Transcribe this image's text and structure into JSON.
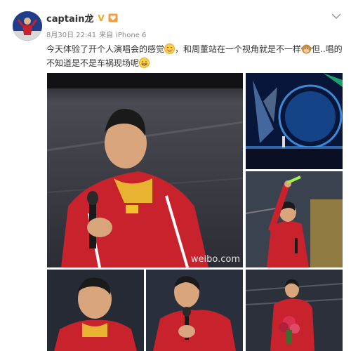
{
  "post": {
    "username": "captain龙",
    "date": "8月30日 22:41",
    "source_prefix": "来自",
    "source": "iPhone 6",
    "text_segments": [
      "今天体验了开个人演唱会的感觉",
      "，和周董站在一个视角就是不一样",
      "但..唱的不知道是不是车祸现场呢"
    ]
  },
  "icons": {
    "avatar": "user-avatar",
    "verified": "verified-v-icon",
    "member": "member-heart-icon",
    "dropdown": "chevron-down-icon",
    "emoji_1": "blush-emoji-icon",
    "emoji_2": "monkey-emoji-icon",
    "emoji_3": "grin-emoji-icon"
  },
  "photos": {
    "watermark": "weibo.com",
    "items": [
      {
        "id": "photo-1",
        "subject": "man in red jacket holding microphone"
      },
      {
        "id": "photo-2",
        "subject": "concert stage with lights"
      },
      {
        "id": "photo-3",
        "subject": "man waving light stick"
      },
      {
        "id": "photo-4",
        "subject": "man smiling"
      },
      {
        "id": "photo-5",
        "subject": "man with microphone"
      },
      {
        "id": "photo-6",
        "subject": "man holding flowers"
      }
    ]
  },
  "colors": {
    "jacket_red": "#c8232c",
    "username_text": "#333333",
    "meta_text": "#888888",
    "verified": "#f3a313"
  }
}
